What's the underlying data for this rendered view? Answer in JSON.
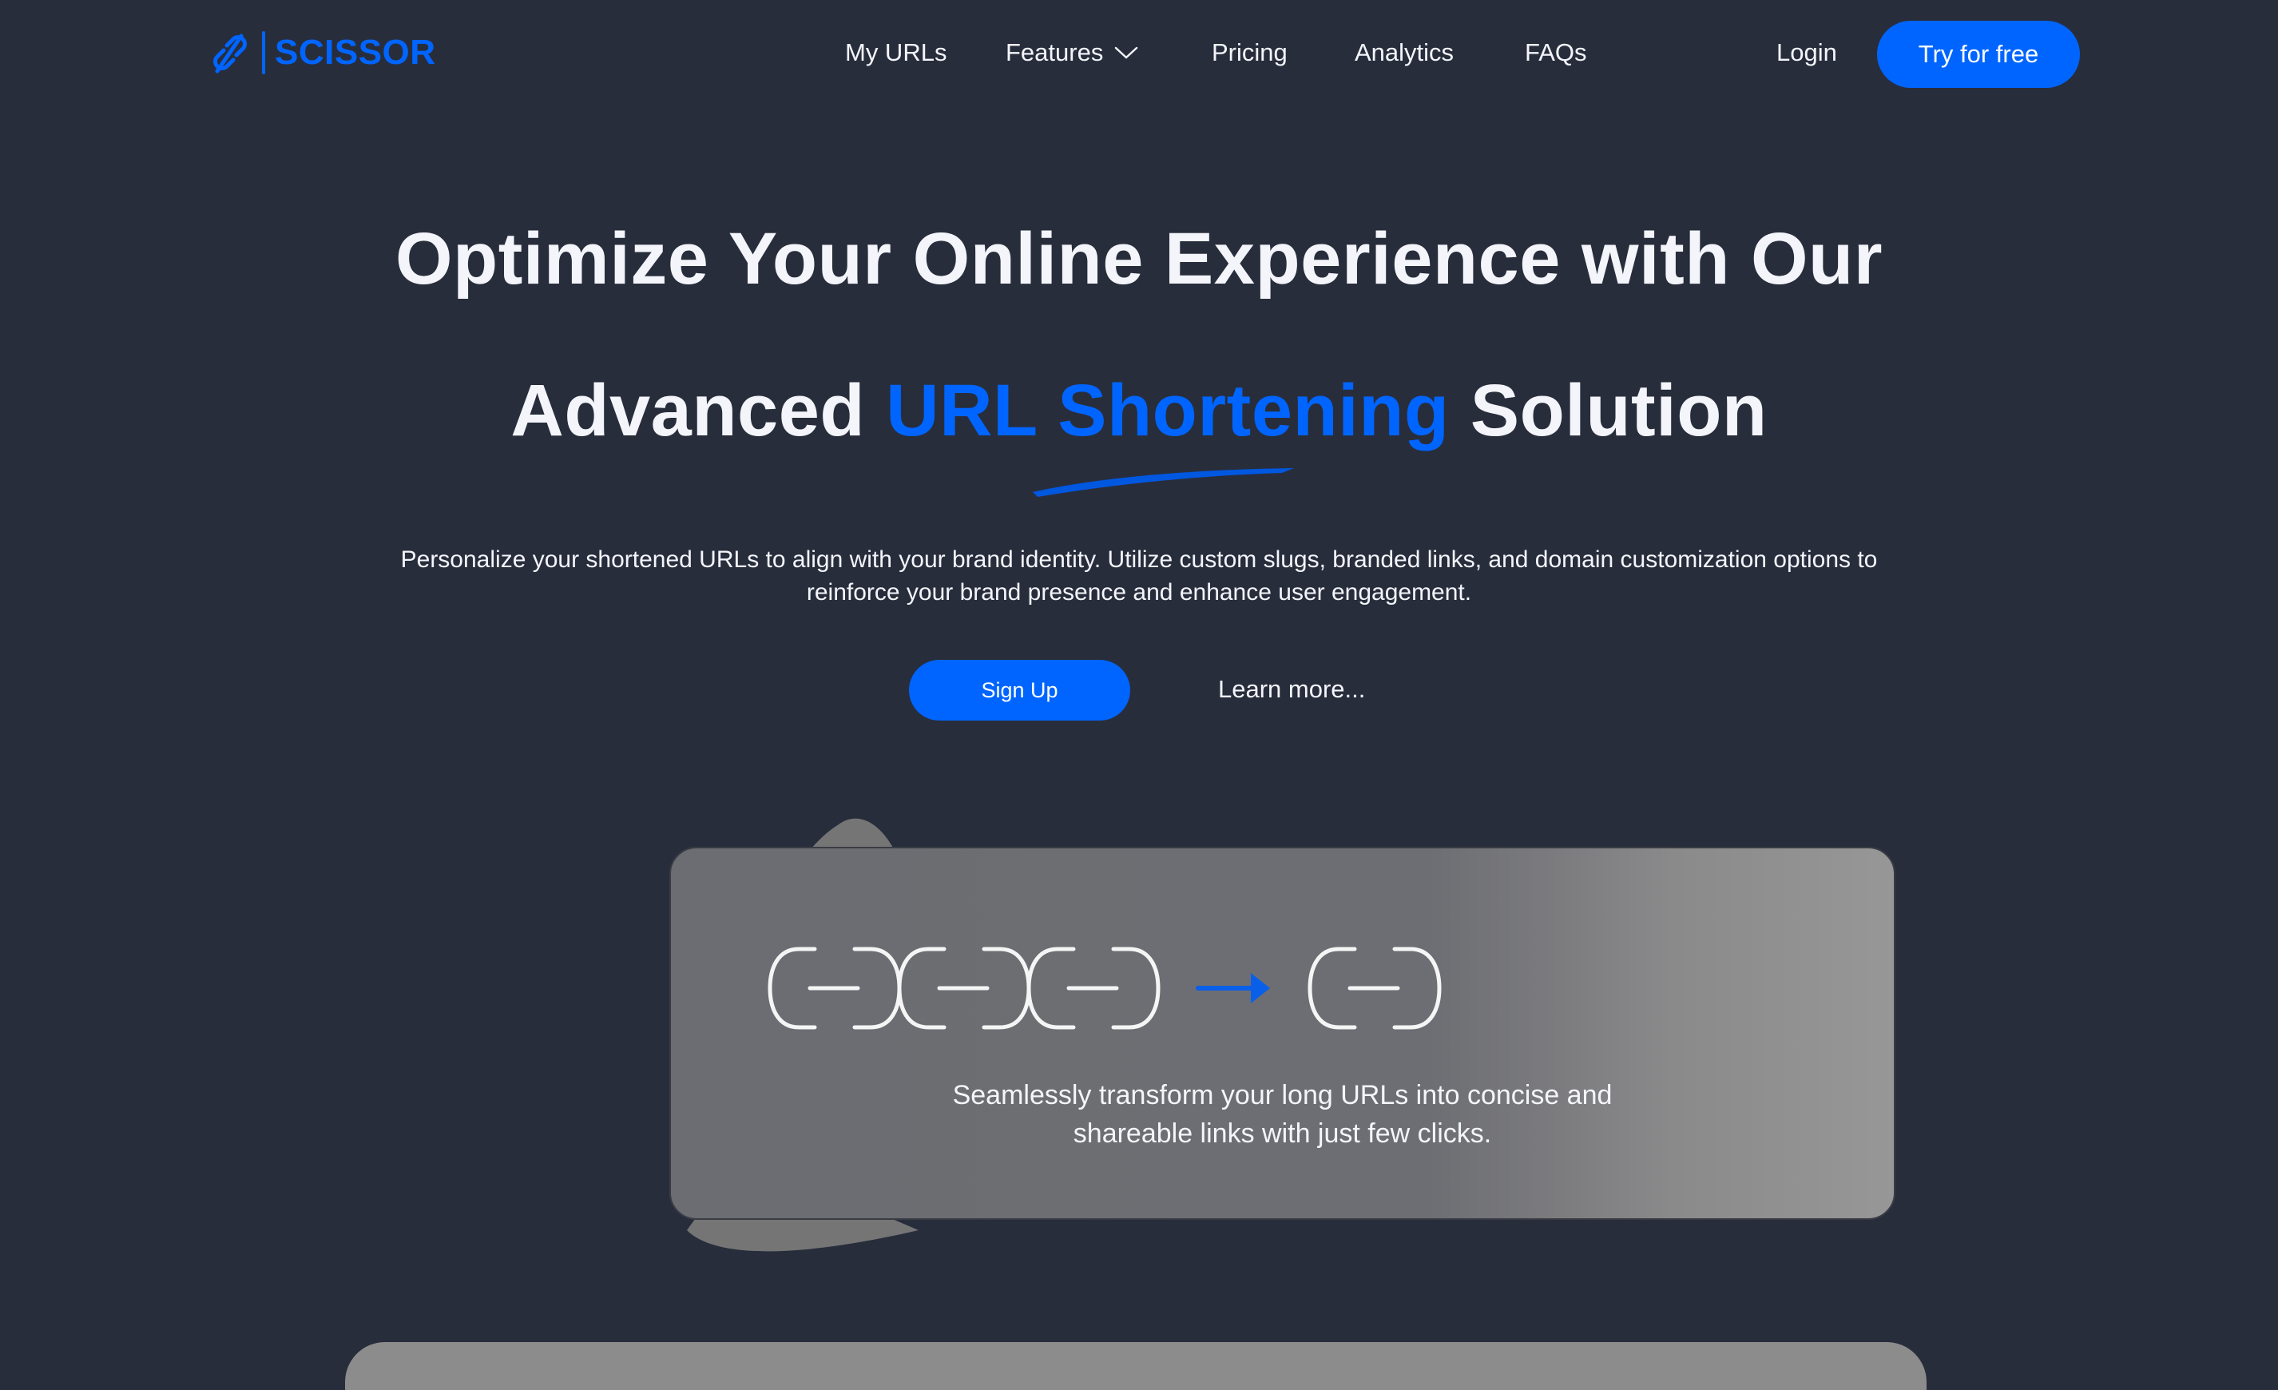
{
  "header": {
    "brand": "SCISSOR",
    "logo_icon": "broken-link-icon",
    "nav": [
      {
        "label": "My URLs"
      },
      {
        "label": "Features",
        "icon": "chevron-down-icon"
      },
      {
        "label": "Pricing"
      },
      {
        "label": "Analytics"
      },
      {
        "label": "FAQs"
      }
    ],
    "login_label": "Login",
    "try_label": "Try for free"
  },
  "hero": {
    "line1": "Optimize Your Online Experience with Our",
    "line2_before": "Advanced ",
    "line2_accent": "URL Shortening",
    "line2_after": " Solution",
    "subtitle": "Personalize your shortened URLs to align with your brand identity. Utilize custom slugs, branded links, and domain customization options to reinforce your brand presence and enhance user engagement.",
    "signup_label": "Sign Up",
    "learn_more_label": "Learn more..."
  },
  "card": {
    "illustration": "long-chain-to-short-chain",
    "arrow_icon": "arrow-right-icon",
    "text_line1": "Seamlessly transform your long URLs into concise and",
    "text_line2": "shareable links with just few clicks."
  },
  "colors": {
    "background": "#282d3c",
    "brand_blue": "#0065fe",
    "text": "#f3f5fa",
    "card_gray": "#6c6d72"
  }
}
